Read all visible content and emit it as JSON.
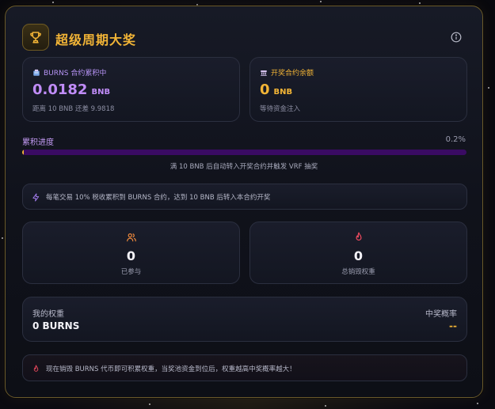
{
  "header": {
    "title": "超级周期大奖"
  },
  "accumulation_card": {
    "label": "BURNS 合约累积中",
    "value": "0.0182",
    "unit": "BNB",
    "note": "距离 10 BNB 还差 9.9818"
  },
  "balance_card": {
    "label": "开奖合约余额",
    "value": "0",
    "unit": "BNB",
    "note": "等待资金注入"
  },
  "progress": {
    "label": "累积进度",
    "percent_text": "0.2%",
    "fraction": 0.002,
    "note": "满 10 BNB 后自动转入开奖合约并触发 VRF 抽奖"
  },
  "info_notice": {
    "text": "每笔交易 10% 税收累积到 BURNS 合约，达到 10 BNB 后转入本合约开奖"
  },
  "stats": [
    {
      "value": "0",
      "label": "已参与",
      "icon": "users-icon"
    },
    {
      "value": "0",
      "label": "总销毁权重",
      "icon": "flame-icon"
    }
  ],
  "my_weight": {
    "label": "我的权重",
    "value": "0 BURNS",
    "odds_label": "中奖概率",
    "odds_value": "--"
  },
  "burn_notice": {
    "text": "现在销毁 BURNS 代币即可积累权重，当奖池资金到位后，权重越高中奖概率越大！"
  },
  "colors": {
    "accent_gold": "#f2b436",
    "accent_purple": "#b794f6",
    "progress_track": "#3a0b63",
    "flame": "#ef4a5f",
    "users": "#f08a3c"
  }
}
